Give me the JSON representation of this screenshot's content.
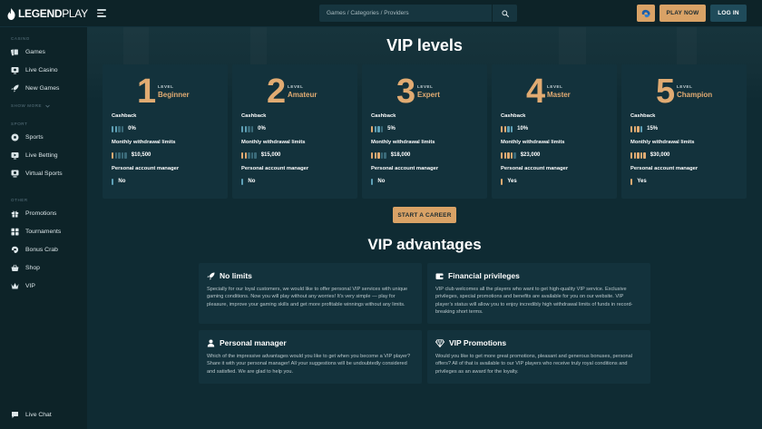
{
  "header": {
    "logo_bold": "LEGEND",
    "logo_light": "PLAY",
    "search_placeholder": "Games / Categories / Providers",
    "play_now_label": "PLAY NOW",
    "login_label": "LOG IN"
  },
  "sidebar": {
    "casino_title": "CASINO",
    "casino_items": [
      {
        "label": "Games",
        "icon": "cards-icon"
      },
      {
        "label": "Live Casino",
        "icon": "live-casino-icon"
      },
      {
        "label": "New Games",
        "icon": "rocket-icon"
      }
    ],
    "show_more": "SHOW MORE",
    "sport_title": "SPORT",
    "sport_items": [
      {
        "label": "Sports",
        "icon": "soccer-ball-icon"
      },
      {
        "label": "Live Betting",
        "icon": "live-betting-icon"
      },
      {
        "label": "Virtual Sports",
        "icon": "virtual-sports-icon"
      }
    ],
    "other_title": "OTHER",
    "other_items": [
      {
        "label": "Promotions",
        "icon": "gift-icon"
      },
      {
        "label": "Tournaments",
        "icon": "tournaments-icon"
      },
      {
        "label": "Bonus Crab",
        "icon": "crab-icon"
      },
      {
        "label": "Shop",
        "icon": "shop-basket-icon"
      },
      {
        "label": "VIP",
        "icon": "crown-icon"
      }
    ],
    "live_chat": "Live Chat"
  },
  "vip": {
    "title": "VIP levels",
    "level_word": "LEVEL",
    "cashback_label": "Cashback",
    "withdrawal_label": "Monthly withdrawal limits",
    "manager_label": "Personal account manager",
    "levels": [
      {
        "num": "1",
        "name": "Beginner",
        "cashback": "0%",
        "cashback_level": 0,
        "withdrawal": "$10,500",
        "withdrawal_level": 1,
        "manager": "No",
        "manager_level": 0
      },
      {
        "num": "2",
        "name": "Amateur",
        "cashback": "0%",
        "cashback_level": 0,
        "withdrawal": "$15,000",
        "withdrawal_level": 2,
        "manager": "No",
        "manager_level": 0
      },
      {
        "num": "3",
        "name": "Expert",
        "cashback": "5%",
        "cashback_level": 1,
        "withdrawal": "$18,000",
        "withdrawal_level": 3,
        "manager": "No",
        "manager_level": 0
      },
      {
        "num": "4",
        "name": "Master",
        "cashback": "10%",
        "cashback_level": 2,
        "withdrawal": "$23,000",
        "withdrawal_level": 4,
        "manager": "Yes",
        "manager_level": 1
      },
      {
        "num": "5",
        "name": "Champion",
        "cashback": "15%",
        "cashback_level": 3,
        "withdrawal": "$30,000",
        "withdrawal_level": 5,
        "manager": "Yes",
        "manager_level": 1
      }
    ],
    "start_career": "START A CAREER"
  },
  "advantages": {
    "title": "VIP advantages",
    "items": [
      {
        "title": "No limits",
        "icon": "rocket-icon",
        "text": "Specially for our loyal customers, we would like to offer personal VIP services with unique gaming conditions. Now you will play without any worries! It’s very simple — play for pleasure, improve your gaming skills and get more profitable winnings without any limits."
      },
      {
        "title": "Financial privileges",
        "icon": "wallet-icon",
        "text": "VIP club welcomes all the players who want to get high-quality VIP service. Exclusive privileges, special promotions and benefits are available for you on our website. VIP player’s status will allow you to enjoy incredibly high withdrawal limits of funds in record-breaking short terms."
      },
      {
        "title": "Personal manager",
        "icon": "person-icon",
        "text": "Which of the impressive advantages would you like to get when you become a VIP player? Share it with your personal manager! All your suggestions will be undoubtedly considered and satisfied. We are glad to help you."
      },
      {
        "title": "VIP Promotions",
        "icon": "diamond-icon",
        "text": "Would you like to get more great promotions, pleasant and generous bonuses, personal offers? All of that is available to our VIP players who receive truly royal conditions and privileges as an award for the loyalty."
      }
    ]
  },
  "colors": {
    "accent_gold": "#d9a266",
    "bar_blue": "#5ea0b6",
    "bar_dim": "#3a6a79"
  }
}
